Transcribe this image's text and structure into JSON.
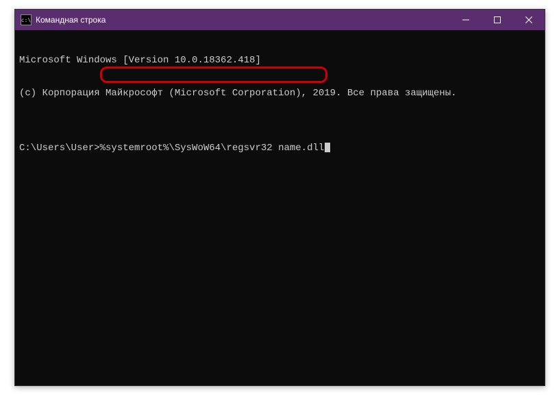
{
  "window": {
    "title": "Командная строка",
    "icon_label": "cmd-icon"
  },
  "terminal": {
    "line1": "Microsoft Windows [Version 10.0.18362.418]",
    "line2": "(c) Корпорация Майкрософт (Microsoft Corporation), 2019. Все права защищены.",
    "blank": "",
    "prompt": "C:\\Users\\User>",
    "command": "%systemroot%\\SysWoW64\\regsvr32 name.dll"
  },
  "colors": {
    "titlebar_bg": "#5a2d6e",
    "terminal_bg": "#0c0c0c",
    "terminal_fg": "#cccccc",
    "highlight_border": "#d00000"
  }
}
